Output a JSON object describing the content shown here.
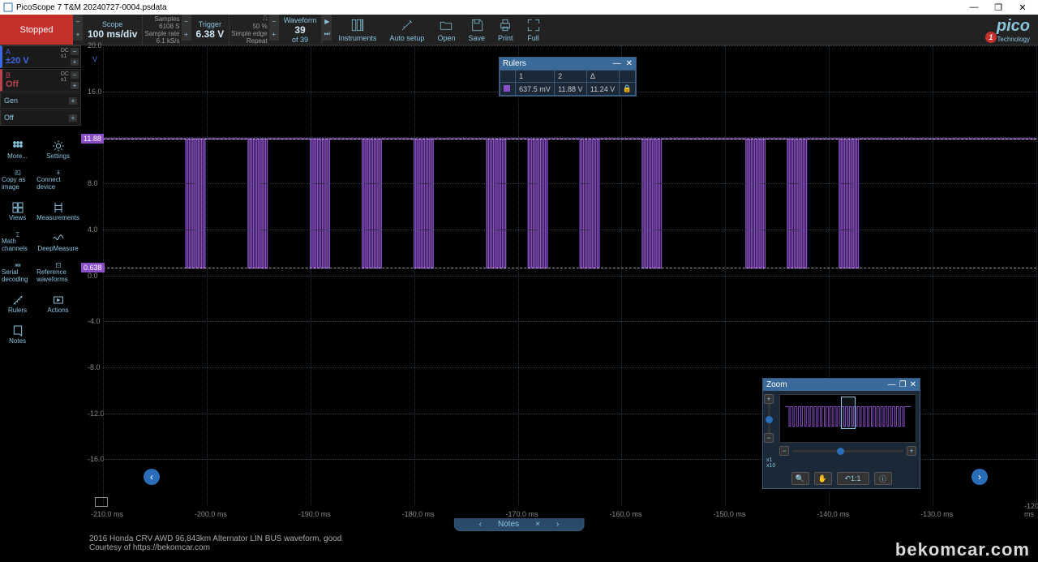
{
  "window": {
    "title": "PicoScope 7 T&M 20240727-0004.psdata"
  },
  "status": {
    "label": "Stopped"
  },
  "scope": {
    "label": "Scope",
    "timebase": "100 ms/div",
    "samples_label": "Samples",
    "samples_value": "6108 S",
    "rate_label": "Sample rate",
    "rate_value": "6.1 kS/s"
  },
  "trigger": {
    "label": "Trigger",
    "level": "6.38 V",
    "pct_label": "50 %",
    "mode": "Simple edge",
    "repeat": "Repeat"
  },
  "waveform": {
    "label": "Waveform",
    "current": "39",
    "of": "of 39"
  },
  "toolbar_buttons": {
    "instruments": "Instruments",
    "autosetup": "Auto setup",
    "open": "Open",
    "save": "Save",
    "print": "Print",
    "full": "Full"
  },
  "logo": {
    "text": "pico",
    "sub": "Technology",
    "notif": "1"
  },
  "channels": {
    "a": {
      "name": "A",
      "range": "±20 V",
      "dc": "DC",
      "mult": "x1"
    },
    "b": {
      "name": "B",
      "status": "Off",
      "dc": "DC",
      "mult": "x1"
    },
    "gen": {
      "name": "Gen",
      "status": "Off"
    }
  },
  "tools": {
    "more": "More...",
    "settings": "Settings",
    "copy_image": "Copy as image",
    "connect": "Connect device",
    "views": "Views",
    "measurements": "Measurements",
    "math": "Math channels",
    "deepmeasure": "DeepMeasure",
    "serial": "Serial decoding",
    "reference": "Reference waveforms",
    "rulers": "Rulers",
    "actions": "Actions",
    "notes": "Notes"
  },
  "rulers_win": {
    "title": "Rulers",
    "h1": "1",
    "h2": "2",
    "hd": "Δ",
    "v1": "637.5 mV",
    "v2": "11.88 V",
    "vd": "11.24 V"
  },
  "zoom_win": {
    "title": "Zoom",
    "x1": "x1",
    "x10": "x10",
    "ratio": "1:1"
  },
  "notes_bar": {
    "label": "Notes",
    "close": "×"
  },
  "footer": {
    "line1": "2016 Honda CRV AWD 96,843km Alternator LIN BUS waveform, good",
    "line2": "Courtesy of https://bekomcar.com"
  },
  "watermark": "bekomcar.com",
  "chart_data": {
    "type": "line",
    "title": "",
    "xlabel": "",
    "ylabel": "V",
    "y_ticks": [
      20.0,
      16.0,
      12.0,
      8.0,
      4.0,
      0.0,
      -4.0,
      -8.0,
      -12.0,
      -16.0
    ],
    "x_ticks_ms": [
      -210.0,
      -200.0,
      -190.0,
      -180.0,
      -170.0,
      -160.0,
      -150.0,
      -140.0,
      -130.0,
      -120.0
    ],
    "x_unit": "ms",
    "ylim": [
      -20.0,
      20.0
    ],
    "ruler1_v": 0.638,
    "ruler2_v": 11.88,
    "high_level_v": 11.88,
    "low_level_v": 0.638,
    "pulse_bursts_start_ms": [
      -202,
      -196,
      -190,
      -185,
      -180,
      -173,
      -169,
      -164,
      -158,
      -148,
      -144,
      -139
    ],
    "burst_width_ms": 2.0,
    "pulses_per_burst": 6
  }
}
